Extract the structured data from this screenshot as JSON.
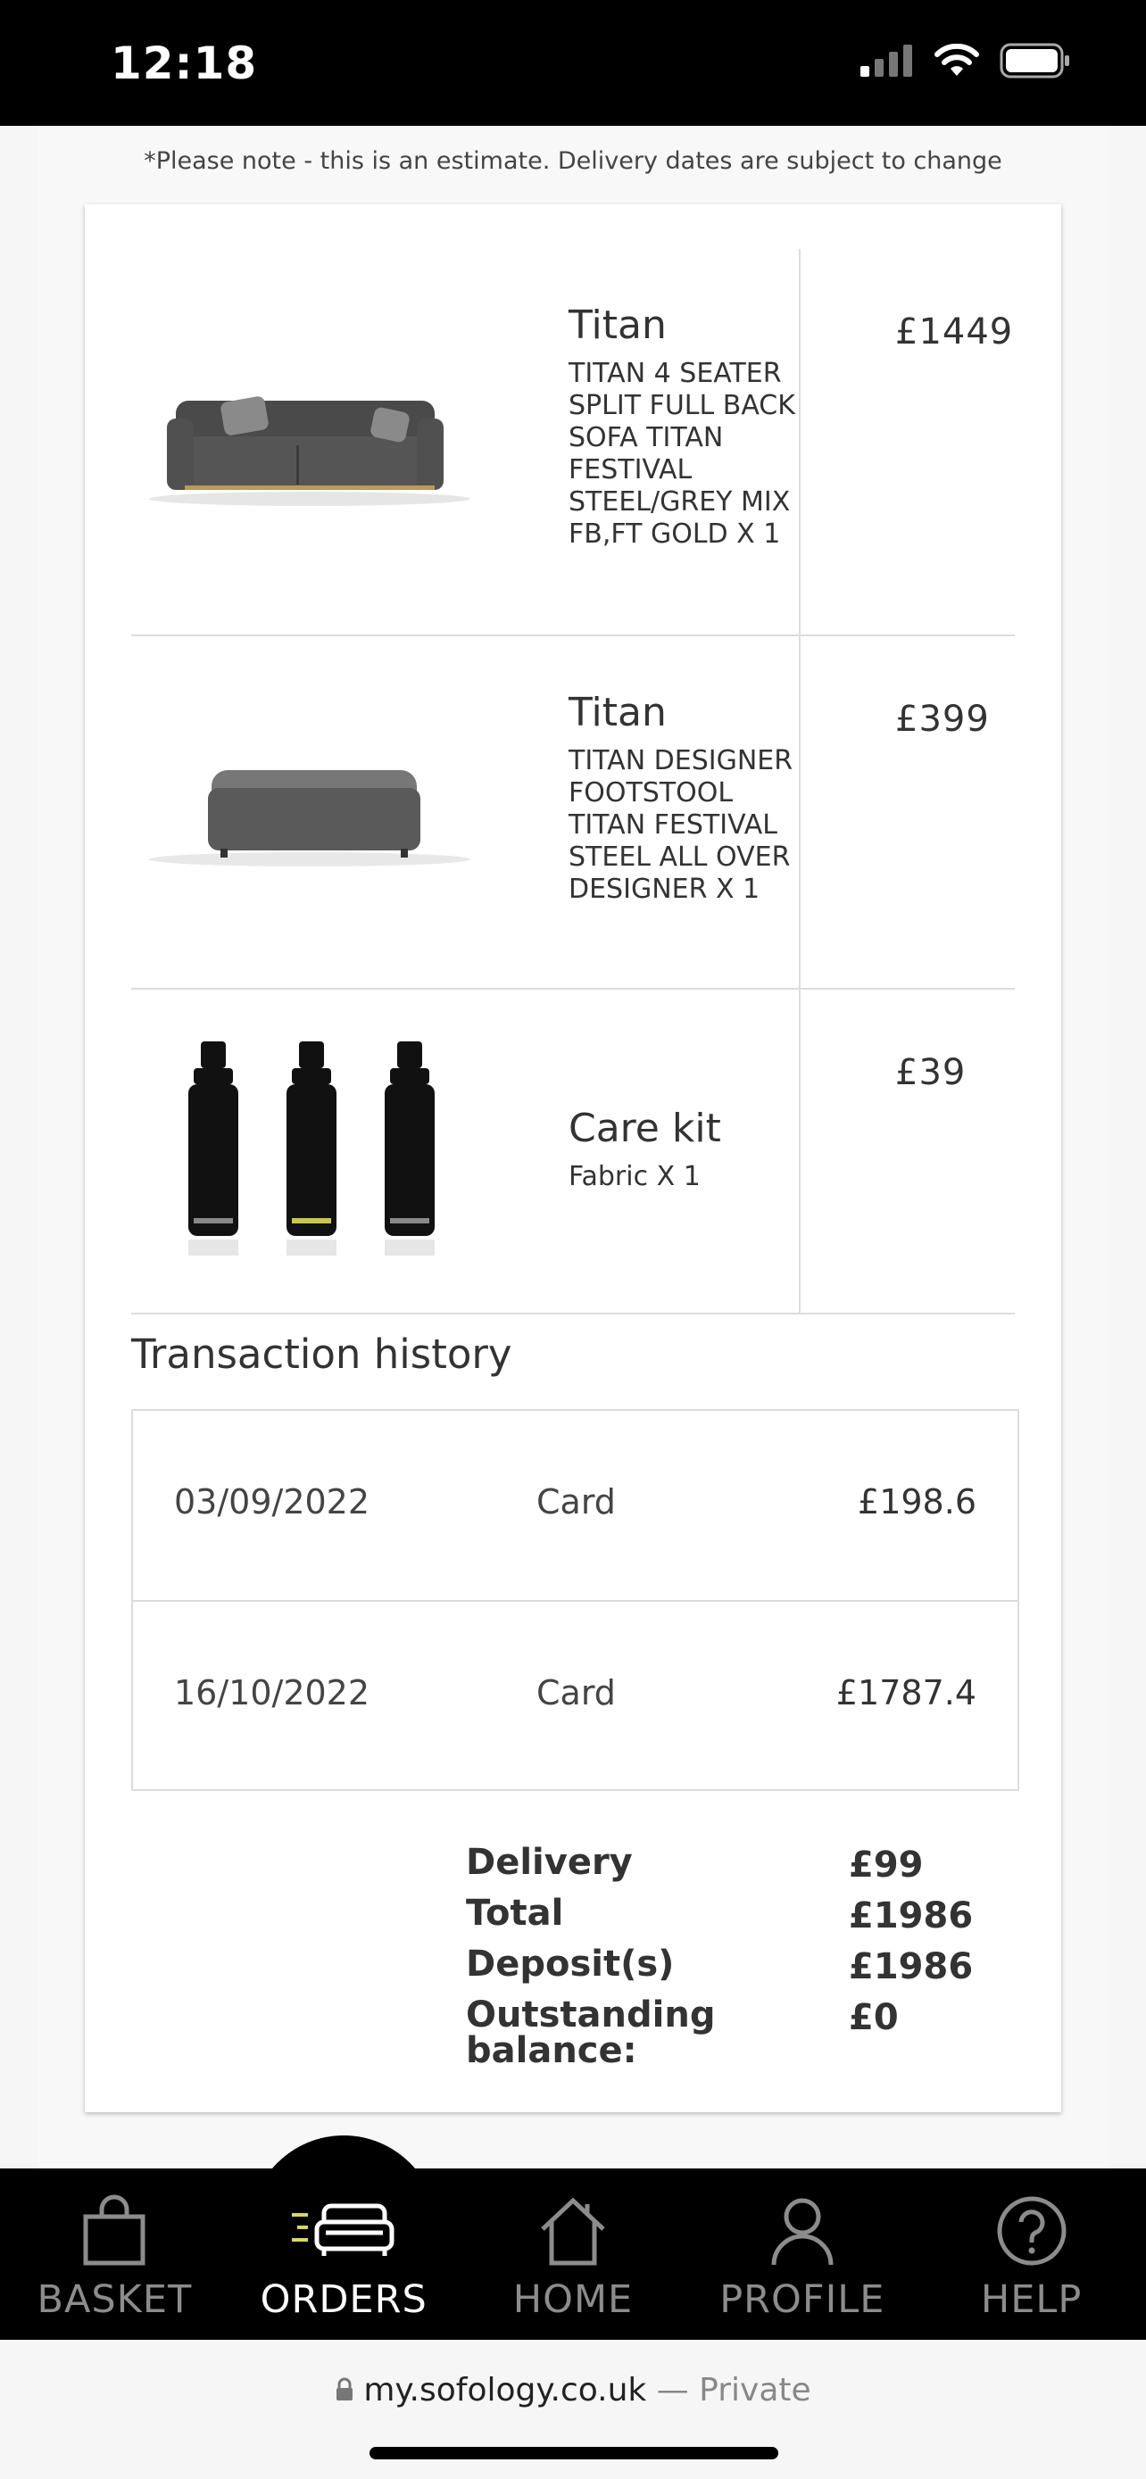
{
  "status_bar": {
    "time": "12:18"
  },
  "delivery_note": "*Please note - this is an estimate. Delivery dates are subject to change",
  "order_items": [
    {
      "name": "Titan",
      "description": "TITAN 4 SEATER SPLIT FULL BACK SOFA TITAN FESTIVAL STEEL/GREY MIX FB,FT GOLD X 1",
      "price": "£1449",
      "image": "grey-sofa"
    },
    {
      "name": "Titan",
      "description": "TITAN DESIGNER FOOTSTOOL TITAN FESTIVAL STEEL ALL OVER DESIGNER X 1",
      "price": "£399",
      "image": "grey-footstool"
    },
    {
      "name": "Care kit",
      "description": "Fabric X 1",
      "price": "£39",
      "image": "spray-bottles"
    }
  ],
  "transaction_history": {
    "title": "Transaction history",
    "rows": [
      {
        "date": "03/09/2022",
        "method": "Card",
        "amount": "£198.6"
      },
      {
        "date": "16/10/2022",
        "method": "Card",
        "amount": "£1787.4"
      }
    ]
  },
  "summary": {
    "delivery_label": "Delivery",
    "delivery_value": "£99",
    "total_label": "Total",
    "total_value": "£1986",
    "deposits_label": "Deposit(s)",
    "deposits_value": "£1986",
    "outstanding_label": "Outstanding balance:",
    "outstanding_value": "£0"
  },
  "tabs": [
    {
      "label": "BASKET",
      "icon": "bag-icon",
      "active": false
    },
    {
      "label": "ORDERS",
      "icon": "sofa-icon",
      "active": true
    },
    {
      "label": "HOME",
      "icon": "home-icon",
      "active": false
    },
    {
      "label": "PROFILE",
      "icon": "profile-icon",
      "active": false
    },
    {
      "label": "HELP",
      "icon": "help-icon",
      "active": false
    }
  ],
  "browser": {
    "domain": "my.sofology.co.uk",
    "mode": "— Private"
  },
  "colors": {
    "tab_bar": "#000000",
    "tab_inactive": "#8c8c8c",
    "tab_active": "#ffffff",
    "orders_accent": "#d8d85a"
  }
}
